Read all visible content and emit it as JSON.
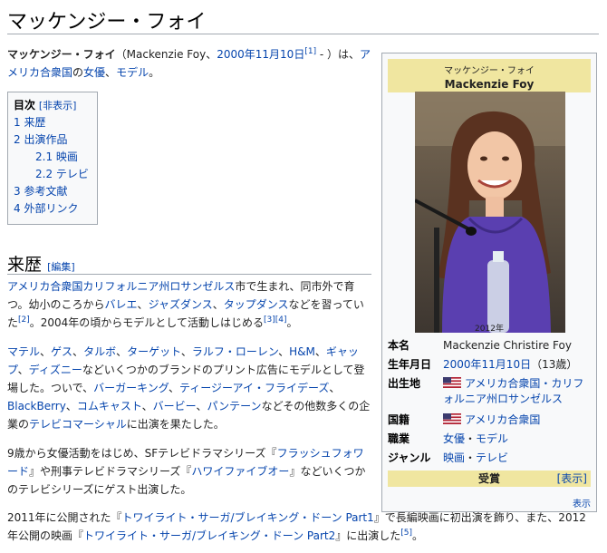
{
  "article": {
    "title": "マッケンジー・フォイ",
    "lead": {
      "name": "マッケンジー・フォイ",
      "paren_open": "（Mackenzie Foy、",
      "birth_link": "2000年11月10日",
      "ref1": "[1]",
      "paren_close": " - ）は、",
      "country_link": "アメリカ合衆国",
      "sep1": "の",
      "job1": "女優",
      "sep2": "、",
      "job2": "モデル",
      "end": "。"
    }
  },
  "toc": {
    "title": "目次",
    "toggle": "[非表示]",
    "items": [
      {
        "num": "1",
        "label": "来歴"
      },
      {
        "num": "2",
        "label": "出演作品"
      },
      {
        "num": "2.1",
        "label": "映画"
      },
      {
        "num": "2.2",
        "label": "テレビ"
      },
      {
        "num": "3",
        "label": "参考文献"
      },
      {
        "num": "4",
        "label": "外部リンク"
      }
    ]
  },
  "section": {
    "title": "来歴",
    "edit": "[編集]"
  },
  "p1": {
    "l_place": "アメリカ合衆国カリフォルニア州ロサンゼルス",
    "t1": "市で生まれ、同市外で育つ。幼小のころから",
    "l_ballet": "バレエ",
    "s1": "、",
    "l_jazz": "ジャズダンス",
    "s2": "、",
    "l_tap": "タップダンス",
    "t2": "などを習っていた",
    "ref2": "[2]",
    "t3": "。2004年の頃からモデルとして活動しはじめる",
    "ref3": "[3]",
    "ref4": "[4]",
    "t4": "。"
  },
  "p2": {
    "b1": "マテル",
    "b2": "ゲス",
    "b3": "タルボ",
    "b4": "ターゲット",
    "b5": "ラルフ・ローレン",
    "b6": "H&M",
    "b7": "ギャップ",
    "b8": "ディズニー",
    "sep": "、",
    "t1": "などいくつかのブランドのプリント広告にモデルとして登場した。ついで、",
    "c1": "バーガーキング",
    "c2": "ティージーアイ・フライデーズ",
    "c3": "BlackBerry",
    "c4": "コムキャスト",
    "c5": "バービー",
    "c6": "パンテーン",
    "t2": "などその他数多くの企業の",
    "c7": "テレビコマーシャル",
    "t3": "に出演を果たした。"
  },
  "p3": {
    "t1": "9歳から女優活動をはじめ、SFテレビドラマシリーズ『",
    "l1": "フラッシュフォワード",
    "t2": "』や刑事テレビドラマシリーズ『",
    "l2": "ハワイファイブオー",
    "t3": "』などいくつかのテレビシリーズにゲスト出演した。"
  },
  "p4": {
    "t1": "2011年に公開された『",
    "l1": "トワイライト・サーガ/ブレイキング・ドーン Part1",
    "t2": "』で長編映画に初出演を飾り、また、2012年公開の映画『",
    "l2": "トワイライト・サーガ/ブレイキング・ドーン Part2",
    "t3": "』に出演した",
    "ref5": "[5]",
    "t4": "。"
  },
  "infobox": {
    "name_jp": "マッケンジー・フォイ",
    "name_en": "Mackenzie Foy",
    "caption": "2012年",
    "rows": {
      "real_name_key": "本名",
      "real_name": "Mackenzie Christire Foy",
      "birth_key": "生年月日",
      "birth_date": "2000年11月10日",
      "birth_age": "（13歳）",
      "birthplace_key": "出生地",
      "birthplace": "アメリカ合衆国・カリフォルニア州ロサンゼルス",
      "nationality_key": "国籍",
      "nationality": "アメリカ合衆国",
      "job_key": "職業",
      "job1": "女優",
      "job_sep": "・",
      "job2": "モデル",
      "genre_key": "ジャンル",
      "genre1": "映画",
      "genre_sep": "・",
      "genre2": "テレビ"
    },
    "award_label": "受賞",
    "award_toggle": "[表示]",
    "footer_link": "表示"
  },
  "colors": {
    "link": "#0645ad",
    "infobox_header": "#f0e6a0",
    "border": "#a2a9b1"
  }
}
